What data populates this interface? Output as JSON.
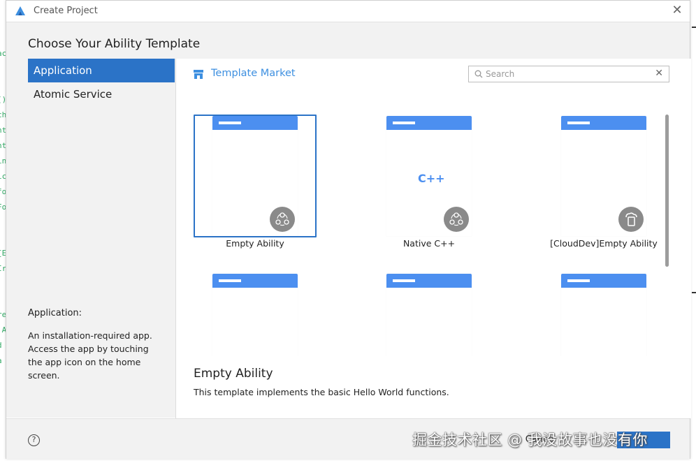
{
  "window": {
    "title": "Create Project"
  },
  "heading": "Choose Your Ability Template",
  "sidebar": {
    "items": [
      {
        "label": "Application",
        "active": true
      },
      {
        "label": "Atomic Service",
        "active": false
      }
    ],
    "description_title": "Application:",
    "description": "An installation-required app. Access the app by touching the app icon on the home screen."
  },
  "market": {
    "label": "Template Market"
  },
  "search": {
    "placeholder": "Search",
    "value": ""
  },
  "templates": [
    {
      "label": "Empty Ability",
      "selected": true,
      "badge": "three-circles-icon"
    },
    {
      "label": "Native C++",
      "selected": false,
      "badge": "three-circles-icon",
      "logo": "C++"
    },
    {
      "label": "[CloudDev]Empty Ability",
      "selected": false,
      "badge": "cloud-dev-icon"
    },
    {
      "label": "",
      "selected": false,
      "badge": "partial-icon"
    },
    {
      "label": "",
      "selected": false,
      "badge": "partial-icon"
    },
    {
      "label": "",
      "selected": false,
      "badge": "partial-icon"
    }
  ],
  "detail": {
    "title": "Empty Ability",
    "description": "This template implements the basic Hello World functions."
  },
  "footer": {
    "cancel_label": "Cance",
    "help_glyph": "?"
  },
  "watermark": "掘金技术社区 @ 我没故事也没有你",
  "colors": {
    "accent": "#2b73c7",
    "thumb_bar": "#4c8ff0",
    "link": "#3d8fe0"
  }
}
